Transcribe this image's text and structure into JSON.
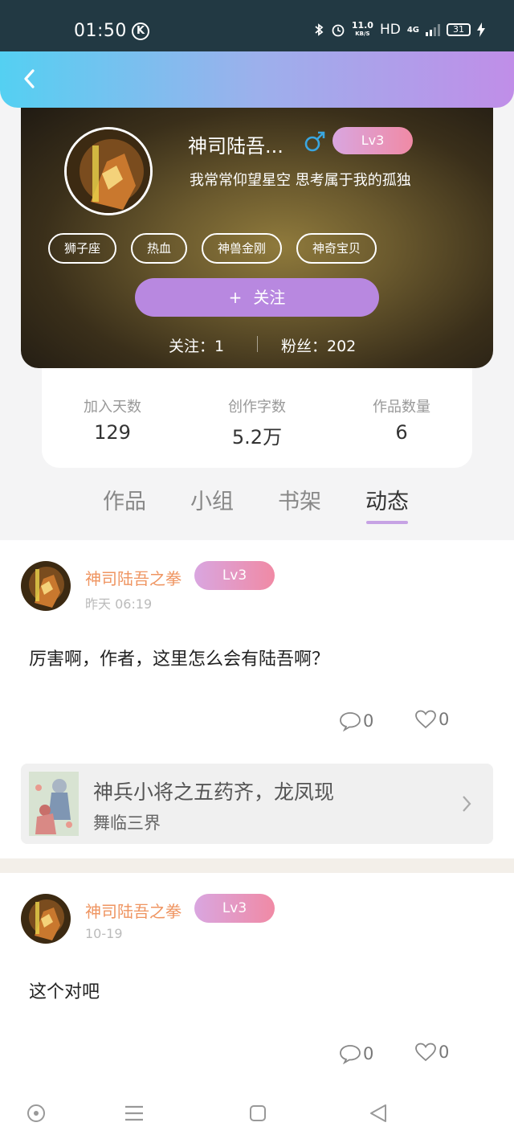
{
  "status_bar": {
    "time": "01:50",
    "k_label": "K",
    "speed_value": "11.0",
    "speed_unit": "KB/S",
    "hd": "HD",
    "network": "4G",
    "battery": "31"
  },
  "profile": {
    "nickname": "神司陆吾...",
    "gender_symbol": "♂",
    "level": "Lv3",
    "signature": "我常常仰望星空 思考属于我的孤独",
    "tags": [
      "狮子座",
      "热血",
      "神兽金刚",
      "神奇宝贝"
    ],
    "follow_plus": "+",
    "follow_label": "关注",
    "following_text": "关注：1",
    "fans_text": "粉丝：202"
  },
  "stats": [
    {
      "label": "加入天数",
      "value": "129"
    },
    {
      "label": "创作字数",
      "value": "5.2万"
    },
    {
      "label": "作品数量",
      "value": "6"
    }
  ],
  "tabs": [
    "作品",
    "小组",
    "书架",
    "动态"
  ],
  "active_tab": "动态",
  "posts": [
    {
      "author": "神司陆吾之拳",
      "level": "Lv3",
      "time": "昨天 06:19",
      "text": "厉害啊，作者，这里怎么会有陆吾啊？",
      "comments": "0",
      "likes": "0",
      "book": {
        "title": "神兵小将之五药齐，龙凤现",
        "subtitle": "舞临三界"
      }
    },
    {
      "author": "神司陆吾之拳",
      "level": "Lv3",
      "time": "10-19",
      "text": "这个对吧",
      "comments": "0",
      "likes": "0"
    }
  ],
  "colors": {
    "header_gradient": [
      "#54d0f2",
      "#c08ee8"
    ],
    "accent_purple": "#b888e0",
    "level_badge": [
      "#d9a6e0",
      "#f08aa5"
    ],
    "author_name": "#ef9460",
    "gender_blue": "#3aa6e0"
  },
  "icons": {
    "back": "chevron-left-icon",
    "gender": "male-icon",
    "comment": "comment-bubble-icon",
    "like": "heart-icon",
    "book_arrow": "chevron-right-icon",
    "nav": [
      "circle-dot-icon",
      "menu-icon",
      "square-icon",
      "triangle-back-icon"
    ]
  }
}
